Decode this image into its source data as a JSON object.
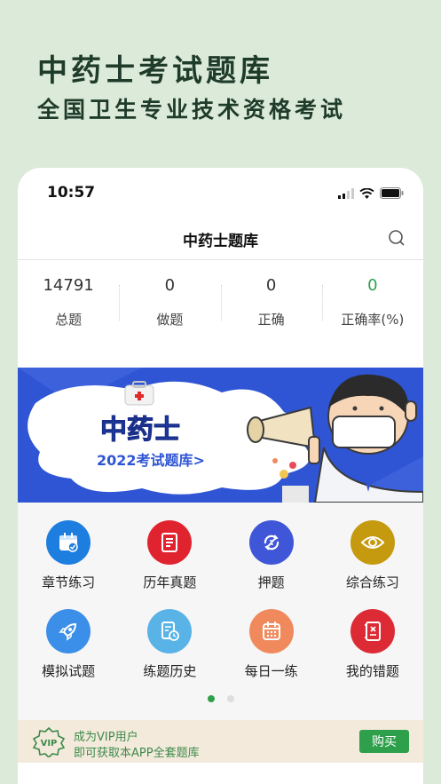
{
  "promo": {
    "title": "中药士考试题库",
    "subtitle": "全国卫生专业技术资格考试"
  },
  "status_bar": {
    "time": "10:57"
  },
  "nav": {
    "title": "中药士题库",
    "search_icon": "search-icon"
  },
  "stats": [
    {
      "value": "14791",
      "label": "总题"
    },
    {
      "value": "0",
      "label": "做题"
    },
    {
      "value": "0",
      "label": "正确"
    },
    {
      "value": "0",
      "label": "正确率(%)"
    }
  ],
  "banner": {
    "title": "中药士",
    "subtitle": "2022考试题库>"
  },
  "menu": [
    {
      "label": "章节练习",
      "icon": "calendar-check-icon",
      "color": "#1e7ee0"
    },
    {
      "label": "历年真题",
      "icon": "document-list-icon",
      "color": "#e0242f"
    },
    {
      "label": "押题",
      "icon": "refresh-icon",
      "color": "#3f56d8"
    },
    {
      "label": "综合练习",
      "icon": "eye-icon",
      "color": "#c59a0f"
    },
    {
      "label": "模拟试题",
      "icon": "rocket-icon",
      "color": "#3c8fe9"
    },
    {
      "label": "练题历史",
      "icon": "history-icon",
      "color": "#59b3e6"
    },
    {
      "label": "每日一练",
      "icon": "daily-calendar-icon",
      "color": "#f08a5d"
    },
    {
      "label": "我的错题",
      "icon": "wrong-book-icon",
      "color": "#dd2b35"
    }
  ],
  "pager": {
    "pages": 2,
    "active": 1
  },
  "vip": {
    "logo_text": "VIP",
    "line1": "成为VIP用户",
    "line2": "即可获取本APP全套题库",
    "button": "购买"
  },
  "colors": {
    "accent": "#2ea04b",
    "background": "#dcebd9",
    "banner": "#2f55d4"
  }
}
